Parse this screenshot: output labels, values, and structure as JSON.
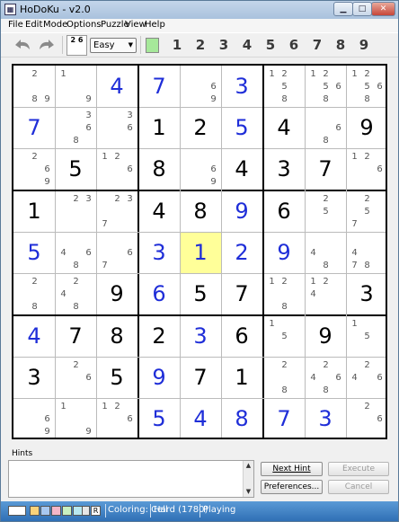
{
  "window": {
    "title": "HoDoKu - v2.0",
    "app_icon": "sudoku-grid-icon"
  },
  "menu": [
    "File",
    "Edit",
    "Mode",
    "Options",
    "Puzzle",
    "View",
    "Help"
  ],
  "toolbar": {
    "level_icon_text": "2 6",
    "level": "Easy",
    "filter_color": "#a6e89a",
    "digits": [
      "1",
      "2",
      "3",
      "4",
      "5",
      "6",
      "7",
      "8",
      "9"
    ]
  },
  "colors": {
    "given": "#000000",
    "solved": "#1f2ed8",
    "selected_cell": "#ffff99",
    "candidate": "#555555"
  },
  "grid": [
    [
      {
        "c": [
          2,
          8,
          9
        ]
      },
      {
        "c": [
          1,
          9
        ]
      },
      {
        "v": 4,
        "t": "s"
      },
      {
        "v": 7,
        "t": "s"
      },
      {
        "c": [
          6,
          9
        ]
      },
      {
        "v": 3,
        "t": "s"
      },
      {
        "c": [
          1,
          2,
          5,
          8
        ]
      },
      {
        "c": [
          1,
          2,
          5,
          6,
          8
        ]
      },
      {
        "c": [
          1,
          2,
          5,
          6,
          8
        ]
      }
    ],
    [
      {
        "v": 7,
        "t": "s"
      },
      {
        "c": [
          3,
          6,
          8
        ]
      },
      {
        "c": [
          3,
          6
        ]
      },
      {
        "v": 1,
        "t": "g"
      },
      {
        "v": 2,
        "t": "g"
      },
      {
        "v": 5,
        "t": "s"
      },
      {
        "v": 4,
        "t": "g"
      },
      {
        "c": [
          6,
          8
        ]
      },
      {
        "v": 9,
        "t": "g"
      }
    ],
    [
      {
        "c": [
          2,
          6,
          9
        ]
      },
      {
        "v": 5,
        "t": "g"
      },
      {
        "c": [
          1,
          2,
          6
        ]
      },
      {
        "v": 8,
        "t": "g"
      },
      {
        "c": [
          6,
          9
        ]
      },
      {
        "v": 4,
        "t": "g"
      },
      {
        "v": 3,
        "t": "g"
      },
      {
        "v": 7,
        "t": "g"
      },
      {
        "c": [
          1,
          2,
          6
        ]
      }
    ],
    [
      {
        "v": 1,
        "t": "g"
      },
      {
        "c": [
          2,
          3
        ]
      },
      {
        "c": [
          2,
          3,
          7
        ]
      },
      {
        "v": 4,
        "t": "g"
      },
      {
        "v": 8,
        "t": "g"
      },
      {
        "v": 9,
        "t": "s"
      },
      {
        "v": 6,
        "t": "g"
      },
      {
        "c": [
          2,
          5
        ]
      },
      {
        "c": [
          2,
          5,
          7
        ]
      }
    ],
    [
      {
        "v": 5,
        "t": "s"
      },
      {
        "c": [
          4,
          6,
          8
        ]
      },
      {
        "c": [
          6,
          7
        ]
      },
      {
        "v": 3,
        "t": "s"
      },
      {
        "v": 1,
        "t": "s",
        "sel": true
      },
      {
        "v": 2,
        "t": "s"
      },
      {
        "v": 9,
        "t": "s"
      },
      {
        "c": [
          4,
          8
        ]
      },
      {
        "c": [
          4,
          7,
          8
        ]
      }
    ],
    [
      {
        "c": [
          2,
          8
        ]
      },
      {
        "c": [
          2,
          4,
          8
        ]
      },
      {
        "v": 9,
        "t": "g"
      },
      {
        "v": 6,
        "t": "s"
      },
      {
        "v": 5,
        "t": "g"
      },
      {
        "v": 7,
        "t": "g"
      },
      {
        "c": [
          1,
          2,
          8
        ]
      },
      {
        "c": [
          1,
          2,
          4
        ]
      },
      {
        "v": 3,
        "t": "g"
      }
    ],
    [
      {
        "v": 4,
        "t": "s"
      },
      {
        "v": 7,
        "t": "g"
      },
      {
        "v": 8,
        "t": "g"
      },
      {
        "v": 2,
        "t": "g"
      },
      {
        "v": 3,
        "t": "s"
      },
      {
        "v": 6,
        "t": "g"
      },
      {
        "c": [
          1,
          5
        ]
      },
      {
        "v": 9,
        "t": "g"
      },
      {
        "c": [
          1,
          5
        ]
      }
    ],
    [
      {
        "v": 3,
        "t": "g"
      },
      {
        "c": [
          2,
          6
        ]
      },
      {
        "v": 5,
        "t": "g"
      },
      {
        "v": 9,
        "t": "s"
      },
      {
        "v": 7,
        "t": "g"
      },
      {
        "v": 1,
        "t": "g"
      },
      {
        "c": [
          2,
          8
        ]
      },
      {
        "c": [
          2,
          4,
          6,
          8
        ]
      },
      {
        "c": [
          2,
          4,
          6
        ]
      }
    ],
    [
      {
        "c": [
          6,
          9
        ]
      },
      {
        "c": [
          1,
          9
        ]
      },
      {
        "c": [
          1,
          2,
          6
        ]
      },
      {
        "v": 5,
        "t": "s"
      },
      {
        "v": 4,
        "t": "s"
      },
      {
        "v": 8,
        "t": "s"
      },
      {
        "v": 7,
        "t": "s"
      },
      {
        "v": 3,
        "t": "s"
      },
      {
        "c": [
          2,
          6
        ]
      }
    ]
  ],
  "hints": {
    "label": "Hints",
    "next_hint": "Next Hint",
    "execute": "Execute",
    "preferences": "Preferences...",
    "cancel": "Cancel"
  },
  "status": {
    "swatches": [
      "#ffffff",
      "#f9d27a",
      "#a8c8f0",
      "#f4b6c8",
      "#c8f0c0",
      "#b8e8f0",
      "#e6e6e6",
      "#ffffff"
    ],
    "r_label": "R",
    "coloring": "Coloring: Cell",
    "difficulty": "Hard (1780)",
    "mode": "Playing"
  }
}
